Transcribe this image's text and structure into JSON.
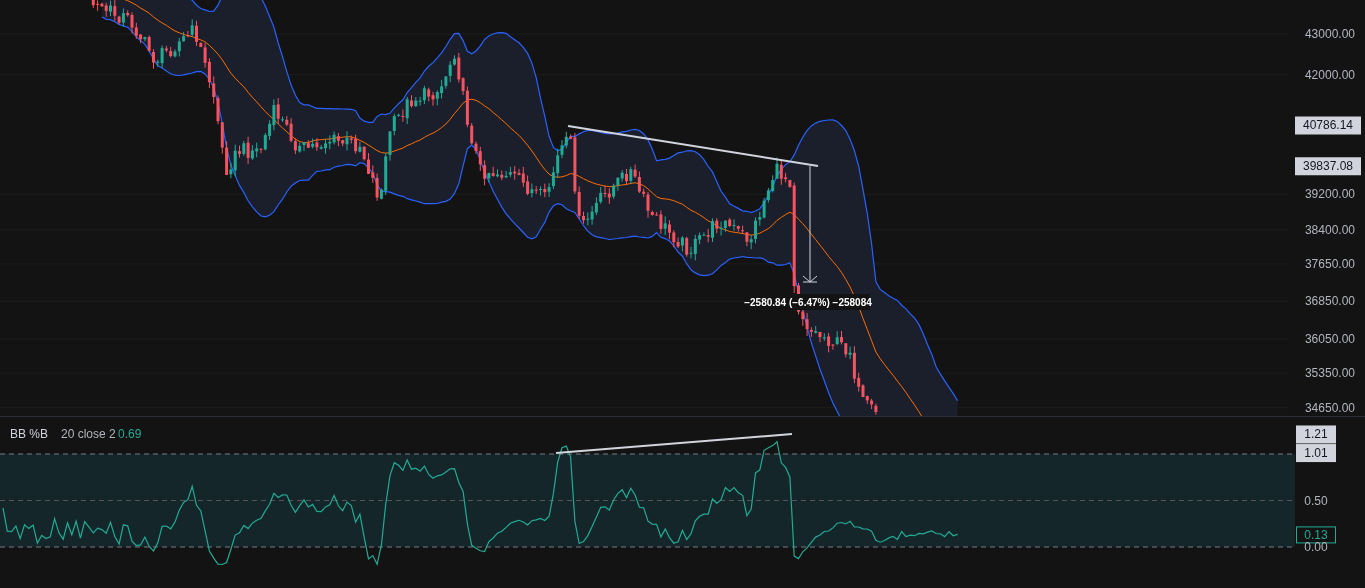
{
  "price_pane": {
    "price_axis": [
      {
        "text": "43000.00",
        "kind": "tick"
      },
      {
        "text": "42000.00",
        "kind": "tick"
      },
      {
        "text": "40786.14",
        "kind": "marker"
      },
      {
        "text": "39837.08",
        "kind": "marker"
      },
      {
        "text": "39200.00",
        "kind": "tick"
      },
      {
        "text": "38400.00",
        "kind": "tick"
      },
      {
        "text": "37650.00",
        "kind": "tick"
      },
      {
        "text": "36850.00",
        "kind": "tick"
      },
      {
        "text": "36050.00",
        "kind": "tick"
      },
      {
        "text": "35350.00",
        "kind": "tick"
      },
      {
        "text": "34650.00",
        "kind": "tick"
      }
    ],
    "measure_label": "−2580.84 (−6.47%) −258084"
  },
  "indicator_pane": {
    "name": "BB %B",
    "params": "20 close 2",
    "value": "0.69",
    "axis": [
      {
        "text": "1.21",
        "kind": "marker"
      },
      {
        "text": "1.01",
        "kind": "marker"
      },
      {
        "text": "0.50",
        "kind": "tick"
      },
      {
        "text": "0.13",
        "kind": "current"
      },
      {
        "text": "0.00",
        "kind": "tick"
      }
    ]
  }
}
